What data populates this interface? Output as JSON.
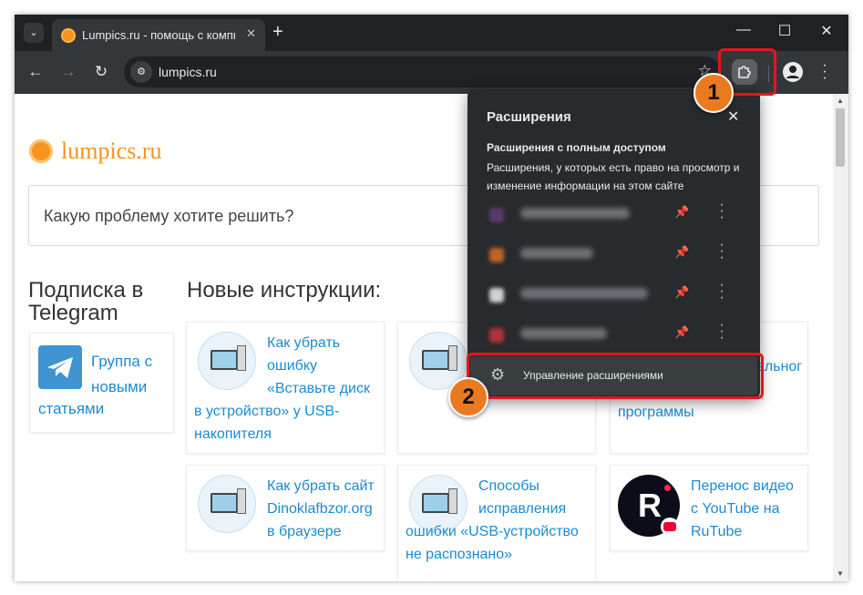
{
  "browser": {
    "tab_title": "Lumpics.ru - помощь с компьютером",
    "tab_close": "✕",
    "new_tab": "+",
    "window_controls": {
      "minimize": "—",
      "maximize": "☐",
      "close": "✕"
    },
    "url": "lumpics.ru",
    "nav": {
      "back": "←",
      "forward": "→",
      "reload": "↻"
    }
  },
  "page": {
    "logo_text": "lumpics.ru",
    "search_placeholder": "Какую проблему хотите решить?",
    "telegram_heading": "Подписка в Telegram",
    "telegram_link_line1": "Группа с новыми",
    "telegram_link_line2": "статьями",
    "news_heading": "Новые инструкции:",
    "articles": [
      {
        "title": "Как убрать ошибку «Вставьте диск",
        "title_cont": "в устройство» у USB-накопителя"
      },
      {
        "title": "",
        "title_cont": ""
      },
      {
        "title": "альног",
        "title_cont": "программы"
      },
      {
        "title": "Как убрать сайт Dinoklafbzor.org",
        "title_cont": "в браузере"
      },
      {
        "title": "Способы исправления",
        "title_cont": "ошибки «USB-устройство не распознано»"
      },
      {
        "title": "Перенос видео с YouTube на RuTube",
        "title_cont": ""
      }
    ]
  },
  "extensions_popup": {
    "title": "Расширения",
    "close": "✕",
    "section_title": "Расширения с полным доступом",
    "section_desc": "Расширения, у которых есть право на просмотр и изменение информации на этом сайте",
    "items": [
      {
        "icon_color": "#5b3a6e"
      },
      {
        "icon_color": "#c0632a"
      },
      {
        "icon_color": "#cfd2d6"
      },
      {
        "icon_color": "#b0323a"
      }
    ],
    "manage_label": "Управление расширениями"
  },
  "annotations": {
    "step1": "1",
    "step2": "2",
    "highlight_color": "#e3161b",
    "badge_color": "#ea7a22"
  }
}
